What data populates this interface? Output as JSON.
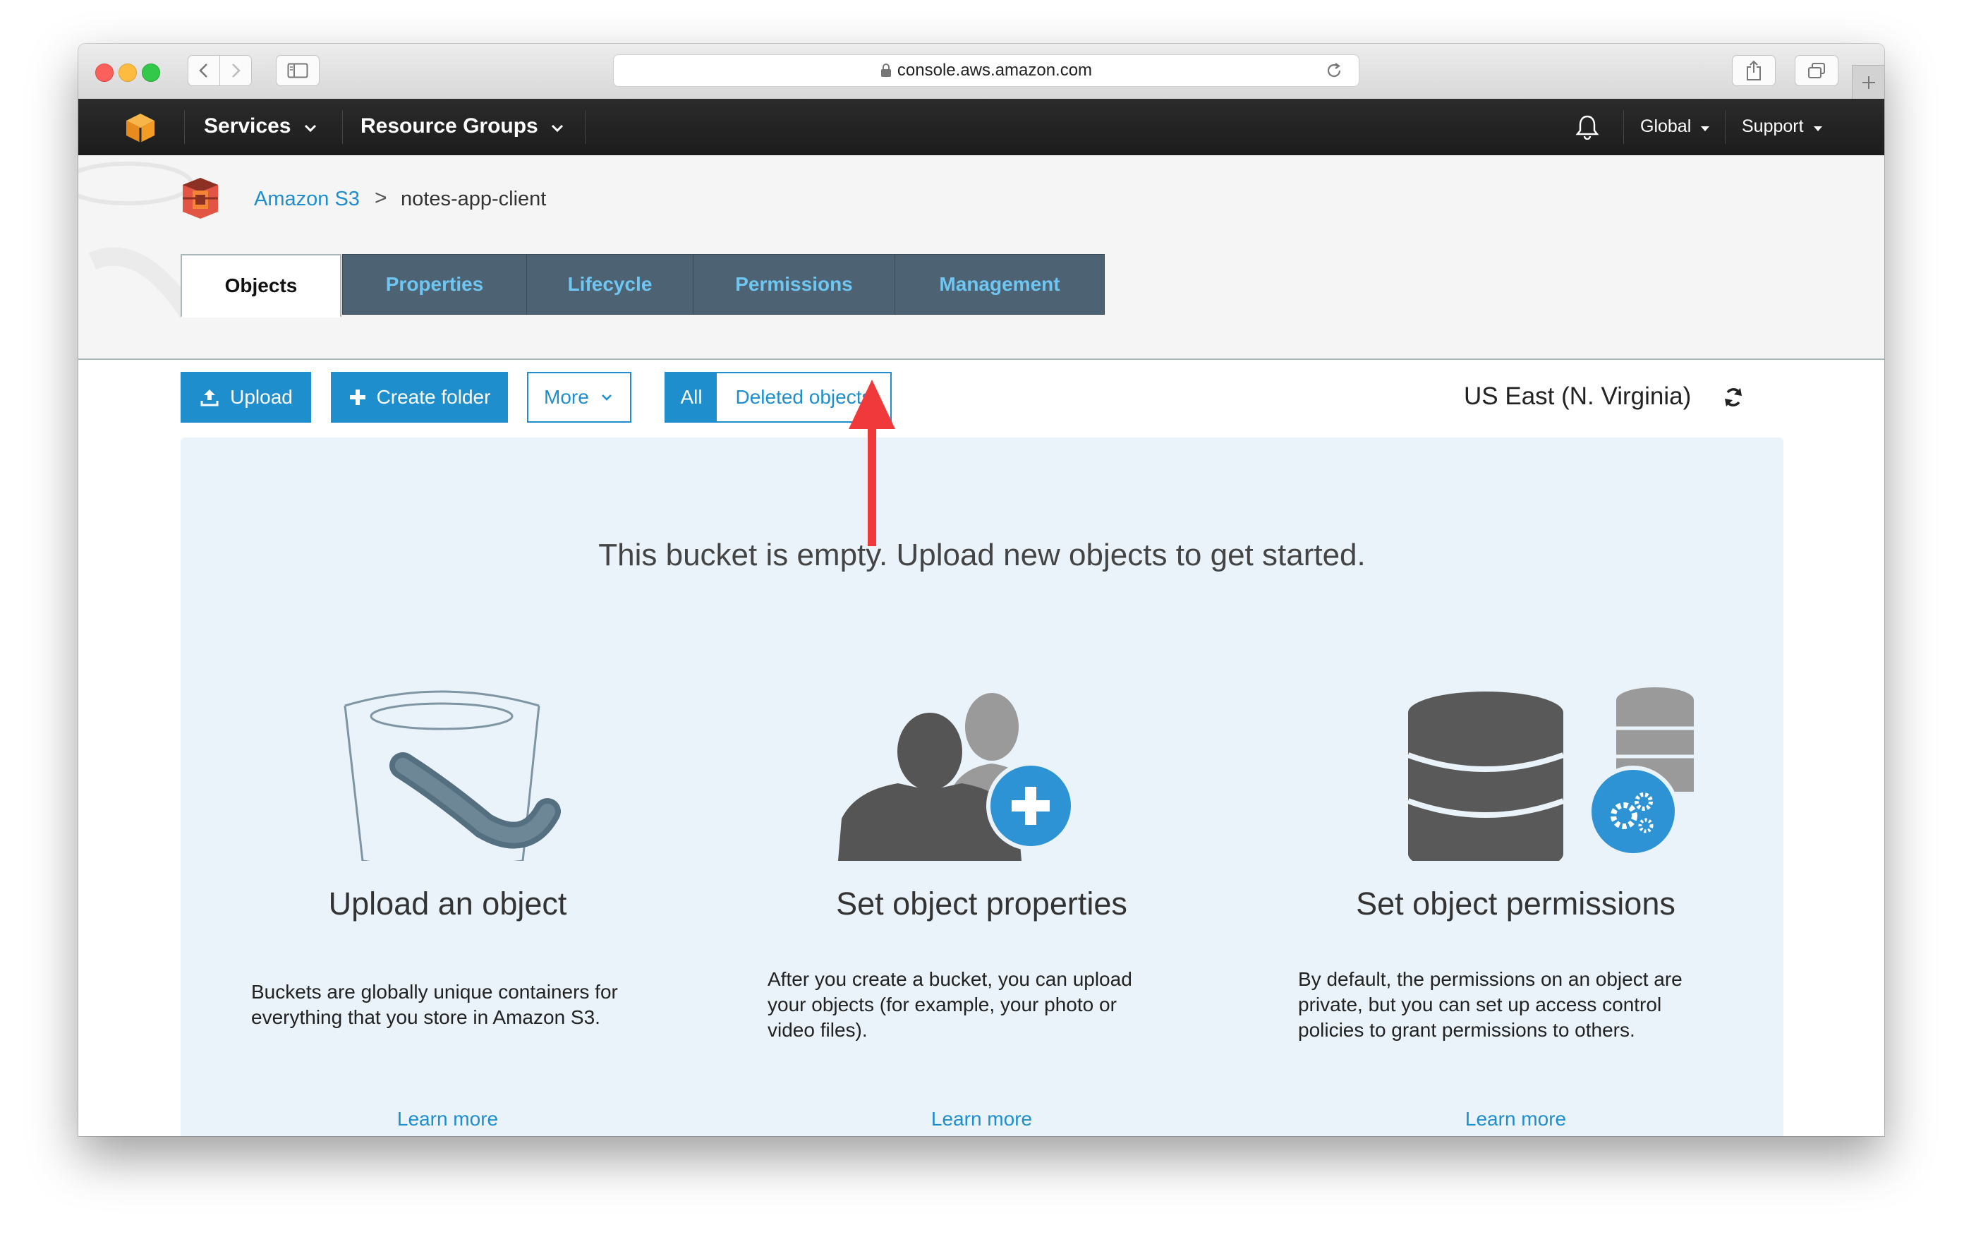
{
  "browser": {
    "url": "console.aws.amazon.com"
  },
  "nav": {
    "services_label": "Services",
    "resource_groups_label": "Resource Groups",
    "global_label": "Global",
    "support_label": "Support"
  },
  "breadcrumb": {
    "root": "Amazon S3",
    "separator": ">",
    "current": "notes-app-client"
  },
  "tabs": [
    {
      "label": "Objects"
    },
    {
      "label": "Properties"
    },
    {
      "label": "Lifecycle"
    },
    {
      "label": "Permissions"
    },
    {
      "label": "Management"
    }
  ],
  "actions": {
    "upload_label": "Upload",
    "create_folder_label": "Create folder",
    "more_label": "More",
    "all_label": "All",
    "deleted_objects_label": "Deleted objects",
    "region_label": "US East (N. Virginia)"
  },
  "empty_state": {
    "message": "This bucket is empty. Upload new objects to get started.",
    "columns": [
      {
        "title": "Upload an object",
        "desc_lines": [
          "Buckets are globally unique containers for",
          "everything that you store in Amazon S3."
        ],
        "link": "Learn more"
      },
      {
        "title": "Set object properties",
        "desc_lines": [
          "After you create a bucket, you can upload",
          "your objects (for example, your photo or",
          "video files)."
        ],
        "link": "Learn more"
      },
      {
        "title": "Set object permissions",
        "desc_lines": [
          "By default, the permissions on an object are",
          "private, but you can set up access control",
          "policies to grant permissions to others."
        ],
        "link": "Learn more"
      }
    ]
  },
  "colors": {
    "aws_nav": "#232f3e",
    "accent_blue": "#1f8ecd",
    "tab_bg": "#4d6373",
    "tab_text": "#6ec6f2",
    "panel_bg": "#eaf3fa",
    "annotation_arrow": "#f0393a"
  }
}
